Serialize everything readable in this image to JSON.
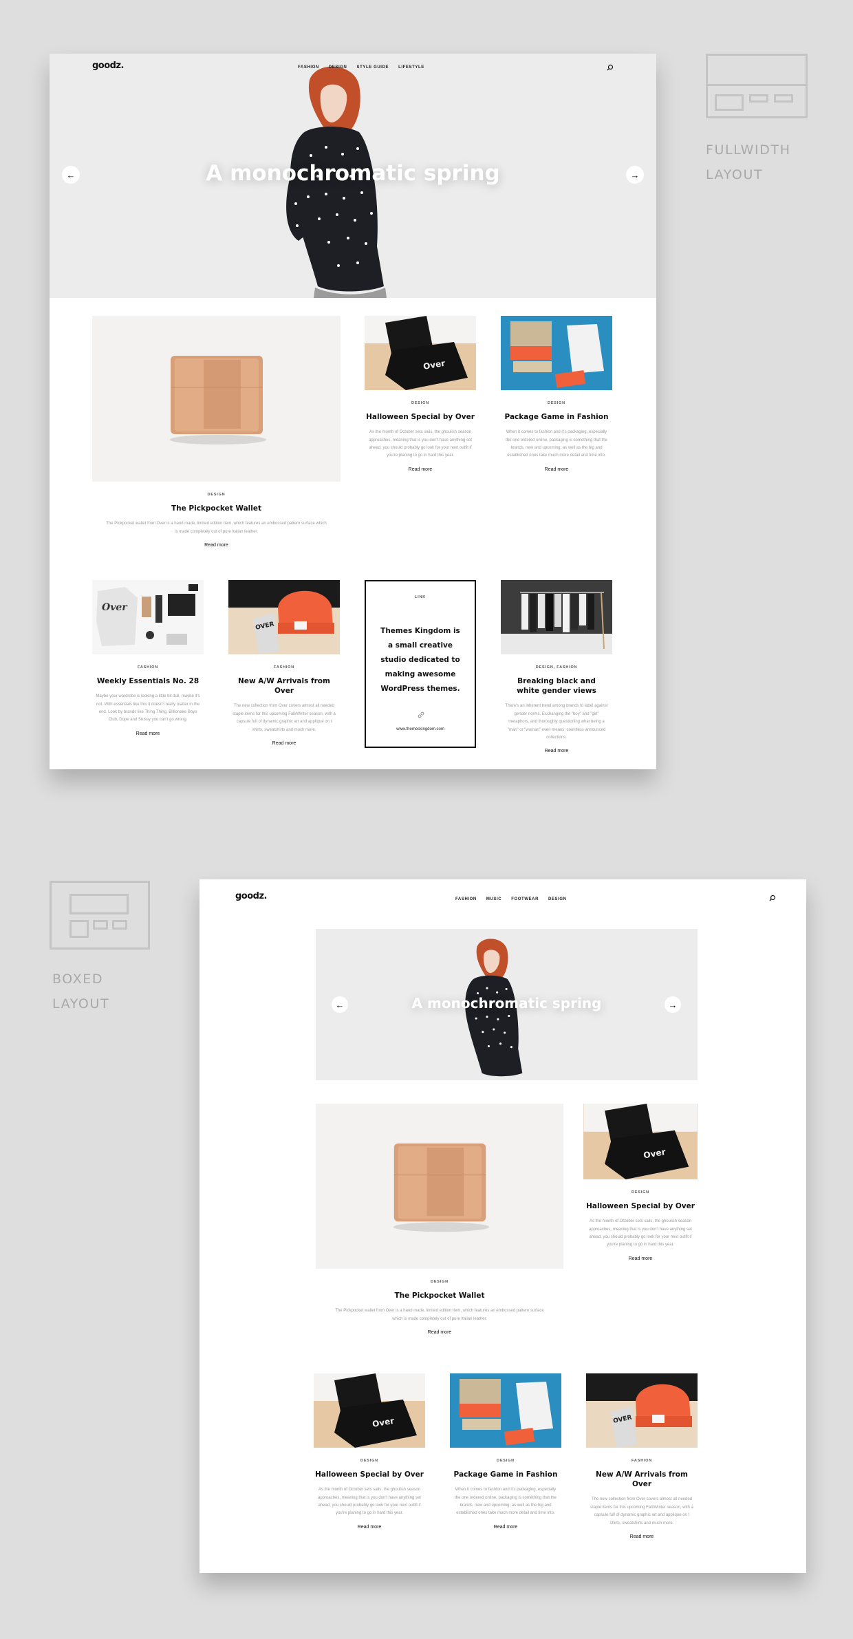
{
  "fullwidth": {
    "logo": "goodz.",
    "nav": [
      "FASHION",
      "DESIGN",
      "STYLE GUIDE",
      "LIFESTYLE"
    ],
    "hero_title": "A monochromatic spring",
    "prev_arrow": "←",
    "next_arrow": "→",
    "featured": {
      "category": "DESIGN",
      "title": "The Pickpocket Wallet",
      "excerpt": "The Pickpocket wallet from Over is a hand made, limited edition item, which features an embossed pattern surface which is made completely out of pure Italian leather.",
      "more": "Read more"
    },
    "top_cards": [
      {
        "category": "DESIGN",
        "title": "Halloween Special by Over",
        "excerpt": "As the month of October sets sails, the ghoulish season approaches, meaning that is you don't have anything set ahead, you should probably go look for your next outfit if you're planing to go in hard this year.",
        "more": "Read more"
      },
      {
        "category": "DESIGN",
        "title": "Package Game in Fashion",
        "excerpt": "When it comes to fashion and it's packaging, especially the one ordered online, packaging is something that the brands, new and upcoming, as well as the big and established ones take much more detail and time into.",
        "more": "Read more"
      }
    ],
    "bottom_cards": [
      {
        "category": "FASHION",
        "title": "Weekly Essentials No. 28",
        "excerpt": "Maybe your wardrobe is looking a little bit dull, maybe it's not. With essentials like this it doesn't really matter in the end. Look by brands like Thing Thing, Billionaire Boys Club, Dope and Stussy you can't go wrong.",
        "more": "Read more"
      },
      {
        "category": "FASHION",
        "title": "New A/W Arrivals from Over",
        "excerpt": "The new collection from Over covers almost all needed staple items for this upcoming Fall/Winter season, with a capsule full of dynamic graphic art and applique on t shirts, sweatshirts and much more.",
        "more": "Read more"
      },
      {
        "category": "DESIGN, FASHION",
        "title": "Breaking black and white gender views",
        "excerpt": "There's an inherent trend among brands to label against gender norms. Exchanging the \"boy\" and \"girl\" metaphors, and thoroughly questioning what being a \"man\" or \"woman\" even means; countless announced collections.",
        "more": "Read more"
      }
    ],
    "link_card": {
      "category": "LINK",
      "text": "Themes Kingdom is a small creative studio dedicated to making awesome WordPress themes.",
      "url": "www.themeskingdom.com"
    }
  },
  "boxed": {
    "logo": "goodz.",
    "nav": [
      "FASHION",
      "MUSIC",
      "FOOTWEAR",
      "DESIGN"
    ],
    "hero_title": "A monochromatic spring",
    "prev_arrow": "←",
    "next_arrow": "→",
    "featured": {
      "category": "DESIGN",
      "title": "The Pickpocket Wallet",
      "excerpt": "The Pickpocket wallet from Over is a hand made, limited edition item, which features an embossed pattern surface which is made completely out of pure Italian leather.",
      "more": "Read more"
    },
    "side_card": {
      "category": "DESIGN",
      "title": "Halloween Special by Over",
      "excerpt": "As the month of October sets sails, the ghoulish season approaches, meaning that is you don't have anything set ahead, you should probably go look for your next outfit if you're planing to go in hard this year.",
      "more": "Read more"
    },
    "bottom_cards": [
      {
        "category": "DESIGN",
        "title": "Halloween Special by Over",
        "excerpt": "As the month of October sets sails, the ghoulish season approaches, meaning that is you don't have anything set ahead, you should probably go look for your next outfit if you're planing to go in hard this year.",
        "more": "Read more"
      },
      {
        "category": "DESIGN",
        "title": "Package Game in Fashion",
        "excerpt": "When it comes to fashion and it's packaging, especially the one ordered online, packaging is something that the brands, new and upcoming, as well as the big and established ones take much more detail and time into.",
        "more": "Read more"
      },
      {
        "category": "FASHION",
        "title": "New A/W Arrivals from Over",
        "excerpt": "The new collection from Over covers almost all needed staple items for this upcoming Fall/Winter season, with a capsule full of dynamic graphic art and applique on t shirts, sweatshirts and much more.",
        "more": "Read more"
      }
    ]
  },
  "labels": {
    "fullwidth": [
      "FULLWIDTH",
      "LAYOUT"
    ],
    "boxed": [
      "BOXED",
      "LAYOUT"
    ]
  },
  "colors": {
    "background": "#dedede",
    "hero": "#ececec",
    "text": "#111111",
    "muted": "#9a9a9a",
    "accent_blue": "#2a8fc0",
    "accent_orange": "#f0603a"
  }
}
